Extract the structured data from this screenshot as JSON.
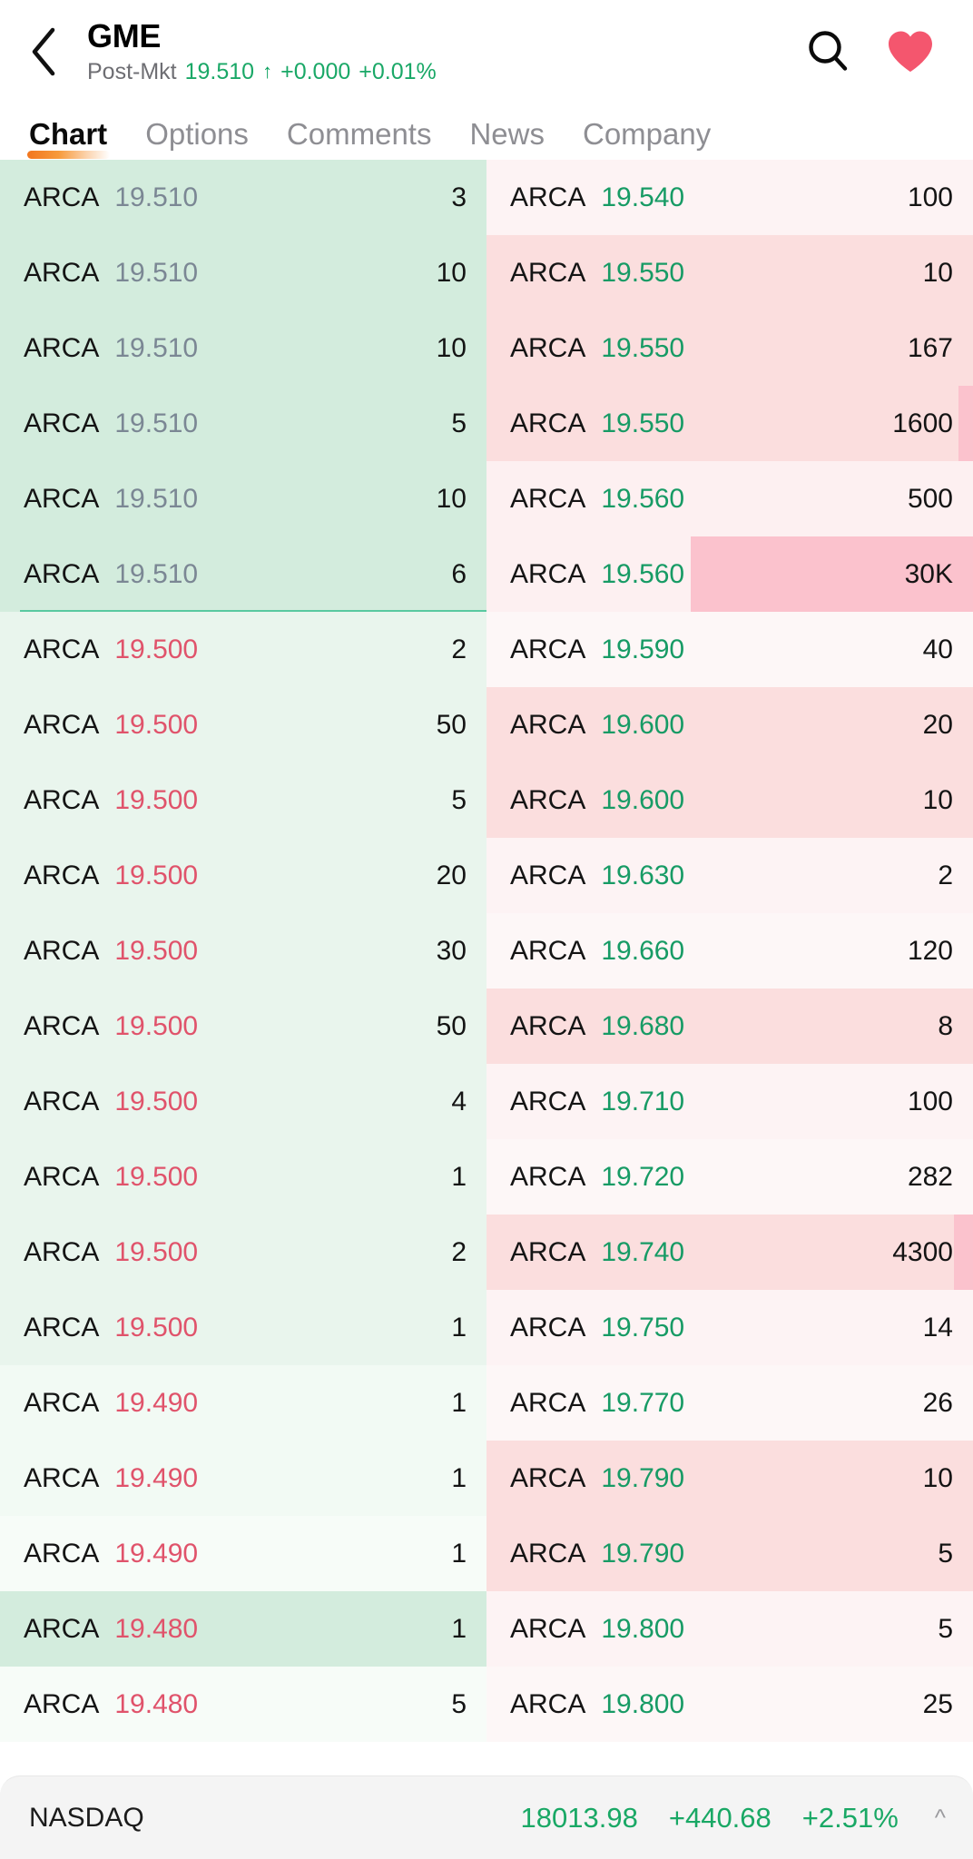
{
  "header": {
    "back_icon": "chevron-left-icon",
    "symbol": "GME",
    "session_label": "Post-Mkt",
    "price": "19.510",
    "arrow": "↑",
    "change": "+0.000",
    "change_pct": "+0.01%",
    "search_icon": "search-icon",
    "favorite_icon": "heart-icon",
    "colors": {
      "up": "#1aa867",
      "down": "#e0536b",
      "heart": "#f4566e",
      "accent": "#f2761f"
    }
  },
  "tabs": [
    {
      "label": "Chart",
      "active": true
    },
    {
      "label": "Options",
      "active": false
    },
    {
      "label": "Comments",
      "active": false
    },
    {
      "label": "News",
      "active": false
    },
    {
      "label": "Company",
      "active": false
    }
  ],
  "book": {
    "bid_header": "bid-side",
    "ask_header": "ask-side",
    "bids": [
      {
        "mm": "ARCA",
        "price": "19.510",
        "size": "3",
        "price_color": "gray",
        "bg": "#d3ecdd",
        "depth_pct": 0
      },
      {
        "mm": "ARCA",
        "price": "19.510",
        "size": "10",
        "price_color": "gray",
        "bg": "#d3ecdd",
        "depth_pct": 0
      },
      {
        "mm": "ARCA",
        "price": "19.510",
        "size": "10",
        "price_color": "gray",
        "bg": "#d3ecdd",
        "depth_pct": 0
      },
      {
        "mm": "ARCA",
        "price": "19.510",
        "size": "5",
        "price_color": "gray",
        "bg": "#d3ecdd",
        "depth_pct": 0
      },
      {
        "mm": "ARCA",
        "price": "19.510",
        "size": "10",
        "price_color": "gray",
        "bg": "#d3ecdd",
        "depth_pct": 0
      },
      {
        "mm": "ARCA",
        "price": "19.510",
        "size": "6",
        "price_color": "gray",
        "bg": "#d3ecdd",
        "depth_pct": 0,
        "separator": true
      },
      {
        "mm": "ARCA",
        "price": "19.500",
        "size": "2",
        "price_color": "red",
        "bg": "#e9f5ed",
        "depth_pct": 0
      },
      {
        "mm": "ARCA",
        "price": "19.500",
        "size": "50",
        "price_color": "red",
        "bg": "#e9f5ed",
        "depth_pct": 0
      },
      {
        "mm": "ARCA",
        "price": "19.500",
        "size": "5",
        "price_color": "red",
        "bg": "#e9f5ed",
        "depth_pct": 0
      },
      {
        "mm": "ARCA",
        "price": "19.500",
        "size": "20",
        "price_color": "red",
        "bg": "#e9f5ed",
        "depth_pct": 0
      },
      {
        "mm": "ARCA",
        "price": "19.500",
        "size": "30",
        "price_color": "red",
        "bg": "#e9f5ed",
        "depth_pct": 0
      },
      {
        "mm": "ARCA",
        "price": "19.500",
        "size": "50",
        "price_color": "red",
        "bg": "#e9f5ed",
        "depth_pct": 0
      },
      {
        "mm": "ARCA",
        "price": "19.500",
        "size": "4",
        "price_color": "red",
        "bg": "#e9f5ed",
        "depth_pct": 0
      },
      {
        "mm": "ARCA",
        "price": "19.500",
        "size": "1",
        "price_color": "red",
        "bg": "#e9f5ed",
        "depth_pct": 0
      },
      {
        "mm": "ARCA",
        "price": "19.500",
        "size": "2",
        "price_color": "red",
        "bg": "#e9f5ed",
        "depth_pct": 0
      },
      {
        "mm": "ARCA",
        "price": "19.500",
        "size": "1",
        "price_color": "red",
        "bg": "#e9f5ed",
        "depth_pct": 0
      },
      {
        "mm": "ARCA",
        "price": "19.490",
        "size": "1",
        "price_color": "red",
        "bg": "#f2faf4",
        "depth_pct": 0
      },
      {
        "mm": "ARCA",
        "price": "19.490",
        "size": "1",
        "price_color": "red",
        "bg": "#f2faf4",
        "depth_pct": 0
      },
      {
        "mm": "ARCA",
        "price": "19.490",
        "size": "1",
        "price_color": "red",
        "bg": "#f7fcf8",
        "depth_pct": 0
      },
      {
        "mm": "ARCA",
        "price": "19.480",
        "size": "1",
        "price_color": "red",
        "bg": "#d3ecdd",
        "depth_pct": 0
      },
      {
        "mm": "ARCA",
        "price": "19.480",
        "size": "5",
        "price_color": "red",
        "bg": "#f7fcf8",
        "depth_pct": 0
      }
    ],
    "asks": [
      {
        "mm": "ARCA",
        "price": "19.540",
        "size": "100",
        "price_color": "green",
        "bg": "#fdf3f4",
        "depth_pct": 0
      },
      {
        "mm": "ARCA",
        "price": "19.550",
        "size": "10",
        "price_color": "green",
        "bg": "#fbdede",
        "depth_pct": 0
      },
      {
        "mm": "ARCA",
        "price": "19.550",
        "size": "167",
        "price_color": "green",
        "bg": "#fbdede",
        "depth_pct": 0
      },
      {
        "mm": "ARCA",
        "price": "19.550",
        "size": "1600",
        "price_color": "green",
        "bg": "#fbdede",
        "depth_pct": 3
      },
      {
        "mm": "ARCA",
        "price": "19.560",
        "size": "500",
        "price_color": "green",
        "bg": "#fdf0f1",
        "depth_pct": 0
      },
      {
        "mm": "ARCA",
        "price": "19.560",
        "size": "30K",
        "price_color": "green",
        "bg": "#fdf0f1",
        "depth_pct": 58
      },
      {
        "mm": "ARCA",
        "price": "19.590",
        "size": "40",
        "price_color": "green",
        "bg": "#fdf7f7",
        "depth_pct": 0
      },
      {
        "mm": "ARCA",
        "price": "19.600",
        "size": "20",
        "price_color": "green",
        "bg": "#fbdede",
        "depth_pct": 0
      },
      {
        "mm": "ARCA",
        "price": "19.600",
        "size": "10",
        "price_color": "green",
        "bg": "#fbdede",
        "depth_pct": 0
      },
      {
        "mm": "ARCA",
        "price": "19.630",
        "size": "2",
        "price_color": "green",
        "bg": "#fdf3f4",
        "depth_pct": 0
      },
      {
        "mm": "ARCA",
        "price": "19.660",
        "size": "120",
        "price_color": "green",
        "bg": "#fdf7f7",
        "depth_pct": 0
      },
      {
        "mm": "ARCA",
        "price": "19.680",
        "size": "8",
        "price_color": "green",
        "bg": "#fbdede",
        "depth_pct": 0
      },
      {
        "mm": "ARCA",
        "price": "19.710",
        "size": "100",
        "price_color": "green",
        "bg": "#fdf3f4",
        "depth_pct": 0
      },
      {
        "mm": "ARCA",
        "price": "19.720",
        "size": "282",
        "price_color": "green",
        "bg": "#fdf7f7",
        "depth_pct": 0
      },
      {
        "mm": "ARCA",
        "price": "19.740",
        "size": "4300",
        "price_color": "green",
        "bg": "#fbdede",
        "depth_pct": 4
      },
      {
        "mm": "ARCA",
        "price": "19.750",
        "size": "14",
        "price_color": "green",
        "bg": "#fdf3f4",
        "depth_pct": 0
      },
      {
        "mm": "ARCA",
        "price": "19.770",
        "size": "26",
        "price_color": "green",
        "bg": "#fdf7f7",
        "depth_pct": 0
      },
      {
        "mm": "ARCA",
        "price": "19.790",
        "size": "10",
        "price_color": "green",
        "bg": "#fbdede",
        "depth_pct": 0
      },
      {
        "mm": "ARCA",
        "price": "19.790",
        "size": "5",
        "price_color": "green",
        "bg": "#fbdede",
        "depth_pct": 0
      },
      {
        "mm": "ARCA",
        "price": "19.800",
        "size": "5",
        "price_color": "green",
        "bg": "#fdf3f4",
        "depth_pct": 0
      },
      {
        "mm": "ARCA",
        "price": "19.800",
        "size": "25",
        "price_color": "green",
        "bg": "#fdf7f7",
        "depth_pct": 0
      }
    ]
  },
  "status_bar": {
    "index_name": "NASDAQ",
    "index_value": "18013.98",
    "index_change": "+440.68",
    "index_pct": "+2.51%",
    "expand_icon": "chevron-up-icon"
  }
}
